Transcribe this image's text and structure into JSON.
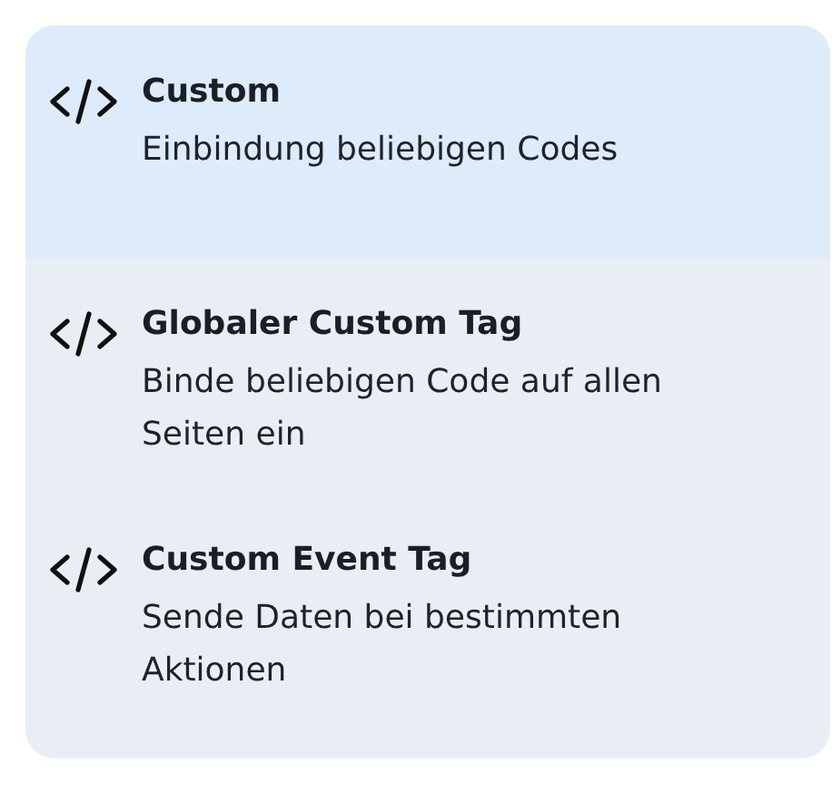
{
  "items": [
    {
      "title": "Custom",
      "description": "Einbindung beliebigen Codes",
      "selected": true
    },
    {
      "title": "Globaler Custom Tag",
      "description": "Binde beliebigen Code auf allen Seiten ein",
      "selected": false
    },
    {
      "title": "Custom Event Tag",
      "description": "Sende Daten bei bestimmten Aktionen",
      "selected": false
    }
  ]
}
